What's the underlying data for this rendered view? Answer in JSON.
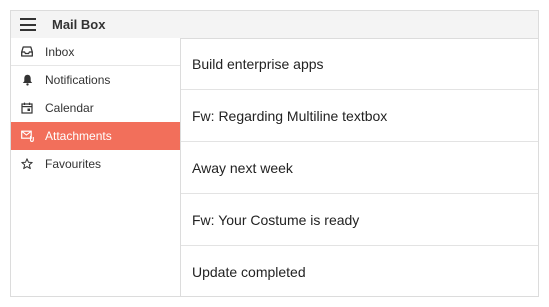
{
  "app": {
    "title": "Mail Box"
  },
  "sidebar": {
    "items": [
      {
        "label": "Inbox",
        "icon": "inbox-icon"
      },
      {
        "label": "Notifications",
        "icon": "bell-icon"
      },
      {
        "label": "Calendar",
        "icon": "calendar-icon"
      },
      {
        "label": "Attachments",
        "icon": "attachment-icon",
        "selected": true
      },
      {
        "label": "Favourites",
        "icon": "star-icon"
      }
    ]
  },
  "mails": [
    {
      "subject": "Build enterprise apps"
    },
    {
      "subject": "Fw: Regarding Multiline textbox"
    },
    {
      "subject": "Away next week"
    },
    {
      "subject": "Fw: Your Costume is ready"
    },
    {
      "subject": "Update completed"
    }
  ],
  "colors": {
    "accent": "#f26f5b"
  }
}
